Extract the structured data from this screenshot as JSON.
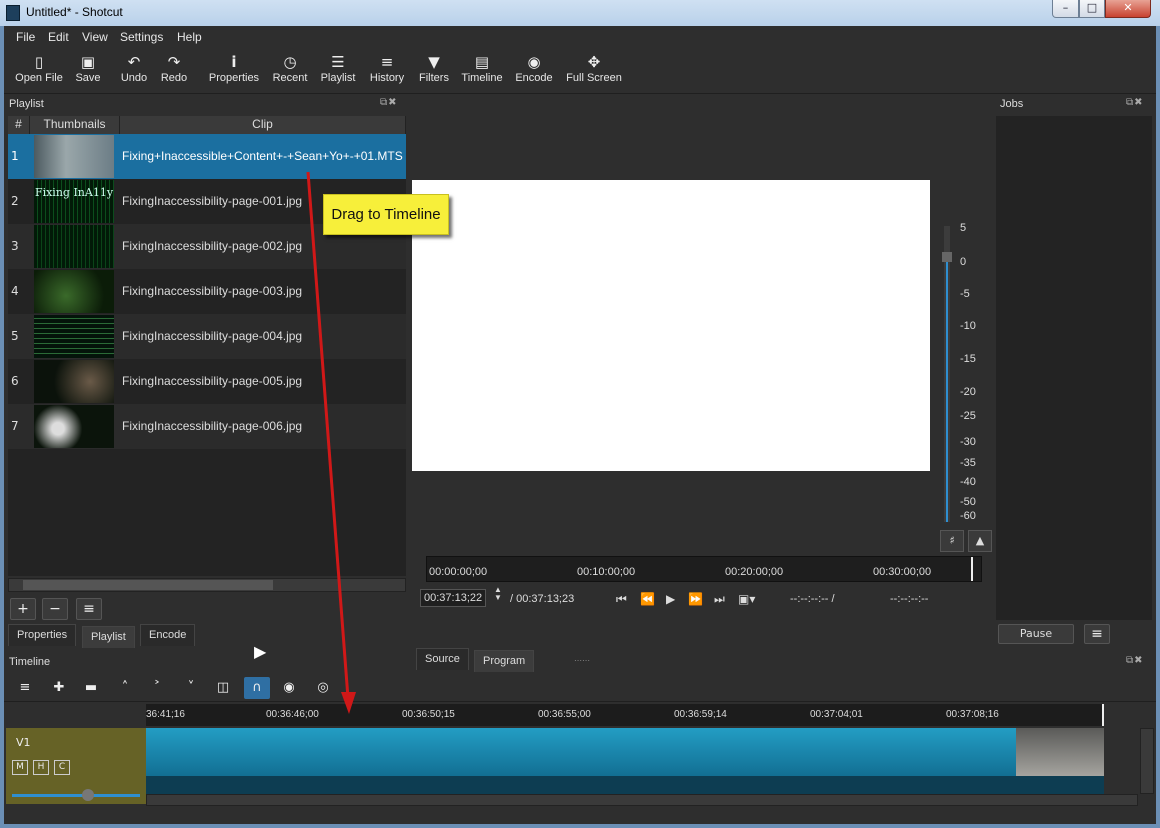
{
  "window": {
    "title": "Untitled* - Shotcut",
    "min": "–",
    "max": "□",
    "close": "✕"
  },
  "menu": [
    "File",
    "Edit",
    "View",
    "Settings",
    "Help"
  ],
  "toolbar": [
    {
      "label": "Open File",
      "icon": "open-file-icon"
    },
    {
      "label": "Save",
      "icon": "save-icon"
    },
    {
      "label": "Undo",
      "icon": "undo-icon"
    },
    {
      "label": "Redo",
      "icon": "redo-icon"
    },
    {
      "label": "Properties",
      "icon": "info-icon"
    },
    {
      "label": "Recent",
      "icon": "clock-icon"
    },
    {
      "label": "Playlist",
      "icon": "list-icon"
    },
    {
      "label": "History",
      "icon": "history-icon"
    },
    {
      "label": "Filters",
      "icon": "funnel-icon"
    },
    {
      "label": "Timeline",
      "icon": "timeline-icon"
    },
    {
      "label": "Encode",
      "icon": "disc-icon"
    },
    {
      "label": "Full Screen",
      "icon": "fullscreen-icon"
    }
  ],
  "playlist": {
    "title": "Playlist",
    "columns": [
      "#",
      "Thumbnails",
      "Clip"
    ],
    "rows": [
      {
        "num": "1",
        "clip": "Fixing+Inaccessible+Content+-+Sean+Yo+-+01.MTS"
      },
      {
        "num": "2",
        "clip": "FixingInaccessibility-page-001.jpg"
      },
      {
        "num": "3",
        "clip": "FixingInaccessibility-page-002.jpg"
      },
      {
        "num": "4",
        "clip": "FixingInaccessibility-page-003.jpg"
      },
      {
        "num": "5",
        "clip": "FixingInaccessibility-page-004.jpg"
      },
      {
        "num": "6",
        "clip": "FixingInaccessibility-page-005.jpg"
      },
      {
        "num": "7",
        "clip": "FixingInaccessibility-page-006.jpg"
      }
    ],
    "thumb2_text": "Fixing InA11y",
    "buttons": {
      "add": "+",
      "remove": "−",
      "menu": "≡"
    },
    "tabs": [
      "Properties",
      "Playlist",
      "Encode"
    ]
  },
  "callout": "Drag to Timeline",
  "viewer": {
    "meter_ticks": [
      "5",
      "0",
      "-5",
      "-10",
      "-15",
      "-20",
      "-25",
      "-30",
      "-35",
      "-40",
      "-50",
      "-60"
    ],
    "ruler_labels": [
      "00:00:00;00",
      "00:10:00;00",
      "00:20:00;00",
      "00:30:00;00"
    ],
    "position": "00:37:13;22",
    "duration": "/ 00:37:13;23",
    "in_point": "--:--:--:-- /",
    "out_point": "--:--:--:--",
    "tabs": [
      "Source",
      "Program"
    ]
  },
  "jobs": {
    "title": "Jobs",
    "pause": "Pause"
  },
  "timeline": {
    "title": "Timeline",
    "ruler_labels": [
      "36:41;16",
      "00:36:46;00",
      "00:36:50;15",
      "00:36:55;00",
      "00:36:59;14",
      "00:37:04;01",
      "00:37:08;16"
    ],
    "track": "V1",
    "track_buttons": [
      "M",
      "H",
      "C"
    ]
  }
}
